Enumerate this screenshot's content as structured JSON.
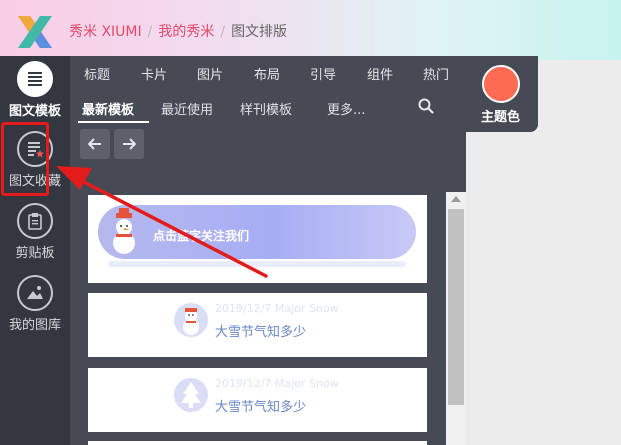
{
  "breadcrumb": {
    "site": "秀米 XIUMI",
    "my": "我的秀米",
    "current": "图文排版",
    "separator": "/"
  },
  "sidebar": {
    "items": [
      {
        "label": "图文模板",
        "icon": "template-icon"
      },
      {
        "label": "图文收藏",
        "icon": "favorites-icon"
      },
      {
        "label": "剪贴板",
        "icon": "clipboard-icon"
      },
      {
        "label": "我的图库",
        "icon": "gallery-icon"
      }
    ]
  },
  "categories": [
    "标题",
    "卡片",
    "图片",
    "布局",
    "引导",
    "组件",
    "热门"
  ],
  "tabs": [
    "最新模板",
    "最近使用",
    "样刊模板",
    "更多..."
  ],
  "active_tab": "最新模板",
  "theme": {
    "label": "主题色",
    "color": "#fe6b53"
  },
  "cards": [
    {
      "type": "banner",
      "text": "点击蓝字关注我们"
    },
    {
      "type": "info",
      "date": "2019/12/7 Major Snow",
      "title": "大雪节气知多少"
    },
    {
      "type": "info",
      "date": "2019/12/7 Major Snow",
      "title": "大雪节气知多少"
    }
  ],
  "colors": {
    "accent": "#e14a6a",
    "annotation": "#e31b1b",
    "dark": "#454a54",
    "sidebar": "#33373f"
  }
}
